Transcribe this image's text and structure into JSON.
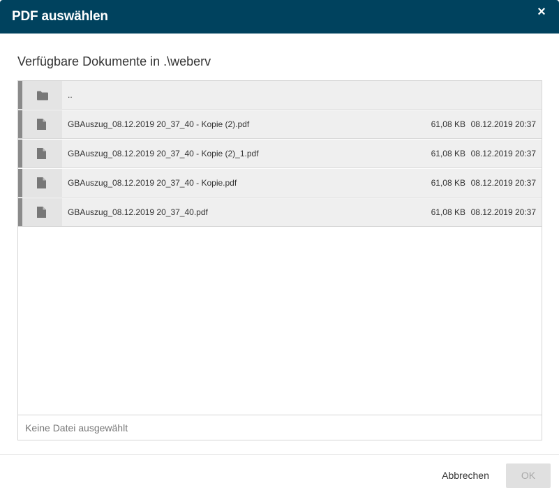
{
  "dialog": {
    "title": "PDF auswählen",
    "close_icon": "×",
    "heading": "Verfügbare Dokumente in .\\weberv",
    "rows": [
      {
        "icon": "folder-icon",
        "name": "..",
        "size": "",
        "date": ""
      },
      {
        "icon": "file-icon",
        "name": "GBAuszug_08.12.2019 20_37_40 - Kopie (2).pdf",
        "size": "61,08 KB",
        "date": "08.12.2019 20:37"
      },
      {
        "icon": "file-icon",
        "name": "GBAuszug_08.12.2019 20_37_40 - Kopie (2)_1.pdf",
        "size": "61,08 KB",
        "date": "08.12.2019 20:37"
      },
      {
        "icon": "file-icon",
        "name": "GBAuszug_08.12.2019 20_37_40 - Kopie.pdf",
        "size": "61,08 KB",
        "date": "08.12.2019 20:37"
      },
      {
        "icon": "file-icon",
        "name": "GBAuszug_08.12.2019 20_37_40.pdf",
        "size": "61,08 KB",
        "date": "08.12.2019 20:37"
      }
    ],
    "selection_text": "Keine Datei ausgewählt",
    "cancel_label": "Abbrechen",
    "ok_label": "OK"
  },
  "colors": {
    "titlebar": "#00425e",
    "row_bar": "#8a8a8a",
    "row_bg": "#efefef",
    "ok_disabled_bg": "#e0e0e0"
  }
}
